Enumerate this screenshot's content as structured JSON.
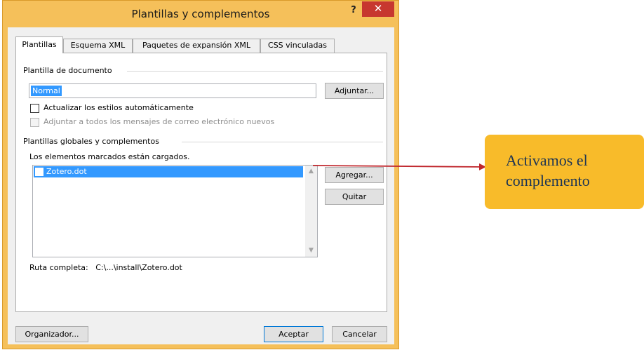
{
  "window": {
    "title": "Plantillas y complementos",
    "help_label": "?",
    "close_label": "✕"
  },
  "tabs": [
    {
      "label": "Plantillas",
      "active": true
    },
    {
      "label": "Esquema XML",
      "active": false
    },
    {
      "label": "Paquetes de expansión XML",
      "active": false
    },
    {
      "label": "CSS vinculadas",
      "active": false
    }
  ],
  "document_template": {
    "group_label": "Plantilla de documento",
    "value": "Normal",
    "attach_button": "Adjuntar...",
    "auto_update_label": "Actualizar los estilos automáticamente",
    "auto_update_checked": false,
    "attach_all_mail_label": "Adjuntar a todos los mensajes de correo electrónico nuevos",
    "attach_all_mail_checked": false
  },
  "global_templates": {
    "group_label": "Plantillas globales y complementos",
    "subtitle": "Los elementos marcados están cargados.",
    "items": [
      {
        "label": "Zotero.dot",
        "checked": false,
        "selected": true
      }
    ],
    "add_button": "Agregar...",
    "remove_button": "Quitar",
    "full_path_label": "Ruta completa:",
    "full_path_value": "C:\\...\\install\\Zotero.dot"
  },
  "footer": {
    "organizer_button": "Organizador...",
    "ok_button": "Aceptar",
    "cancel_button": "Cancelar"
  },
  "callout": {
    "line1": "Activamos el",
    "line2": "complemento",
    "color": "#f8bb2a",
    "arrow_color": "#c0272d"
  },
  "colors": {
    "frame": "#f5c05a",
    "selection": "#3399ff",
    "close_button": "#c7372f"
  }
}
